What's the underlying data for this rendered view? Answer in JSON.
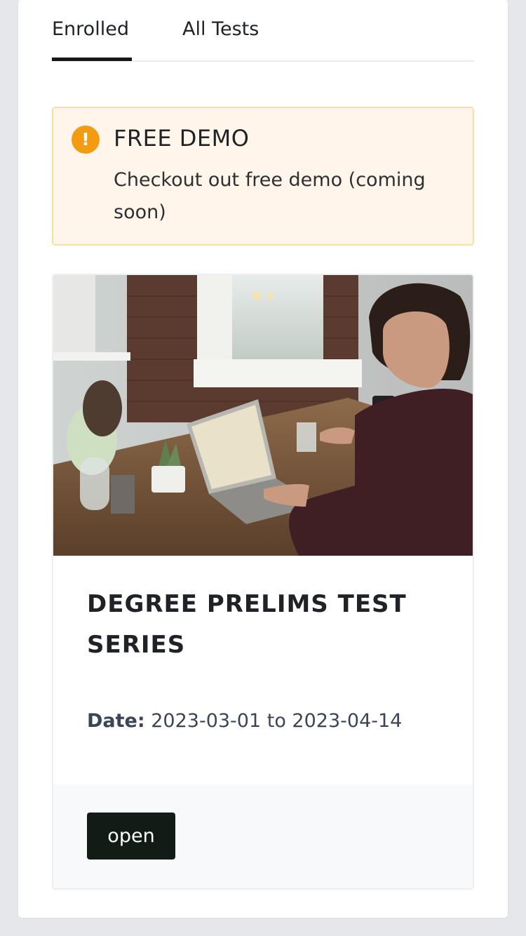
{
  "tabs": [
    {
      "label": "Enrolled",
      "active": true
    },
    {
      "label": "All Tests",
      "active": false
    }
  ],
  "alert": {
    "icon": "exclamation-icon",
    "icon_glyph": "!",
    "title": "FREE DEMO",
    "text": "Checkout out free demo (coming soon)",
    "color": "#f39c12"
  },
  "card": {
    "image": "man-working-on-laptop-photo",
    "title": "DEGREE PRELIMS TEST SERIES",
    "date_label": "Date:",
    "date_value": "2023-03-01 to 2023-04-14",
    "button_label": "open"
  },
  "colors": {
    "accent_dark": "#111c17",
    "alert_bg": "#fff5eb",
    "alert_border": "#f6dfa1"
  }
}
